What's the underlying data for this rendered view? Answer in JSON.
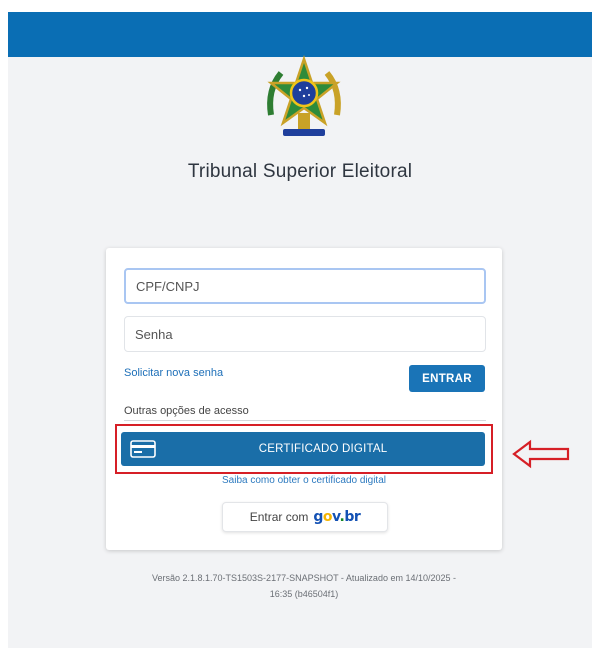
{
  "header": {
    "color": "#0a6eb4"
  },
  "emblem": {
    "icon": "brazil-coat-of-arms-icon"
  },
  "org_title": "Tribunal Superior Eleitoral",
  "login": {
    "cpf_placeholder": "CPF/CNPJ",
    "senha_placeholder": "Senha",
    "recover_link": "Solicitar nova senha",
    "enter_label": "ENTRAR",
    "other_options_label": "Outras opções de acesso",
    "cert_button_label": "CERTIFICADO DIGITAL",
    "cert_icon": "card-icon",
    "cert_help_link": "Saiba como obter o certificado digital",
    "govbr_prefix": "Entrar com",
    "govbr_logo": {
      "g": "g",
      "o": "o",
      "v": "v",
      "dot": ".",
      "br": "br"
    }
  },
  "version": {
    "line1": "Versão 2.1.8.1.70-TS1503S-2177-SNAPSHOT - Atualizado em 14/10/2025 -",
    "line2": "16:35 (b46504f1)"
  },
  "annotation": {
    "highlight_color": "#d61f26",
    "arrow_icon": "left-arrow-icon"
  }
}
